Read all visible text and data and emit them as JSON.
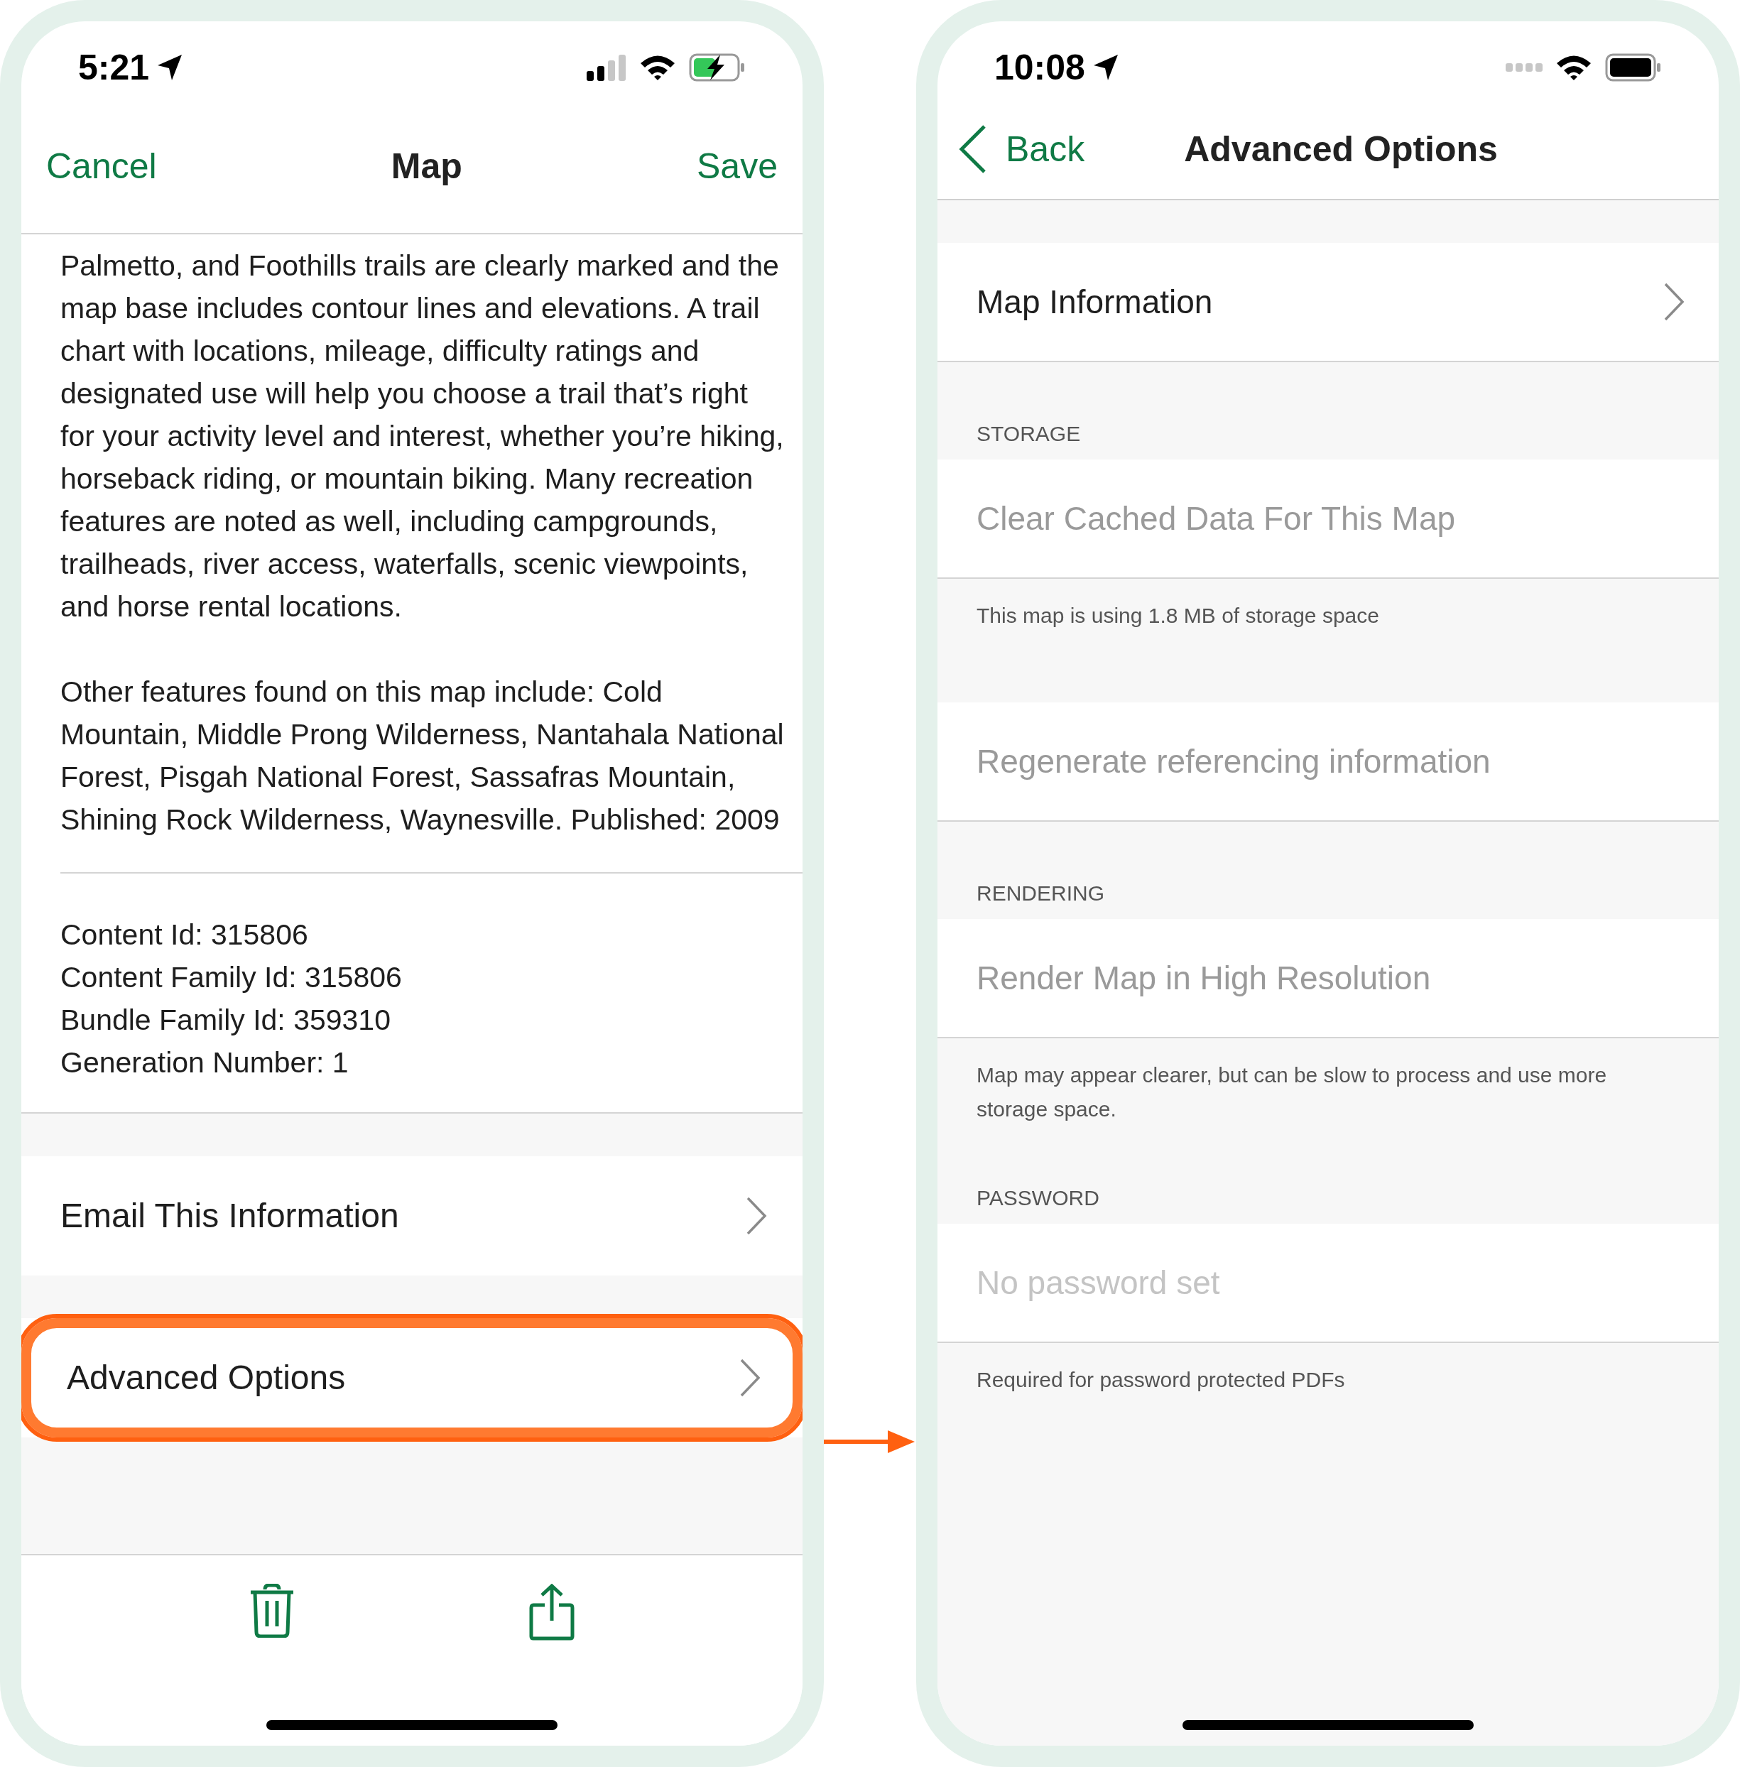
{
  "left_screen": {
    "status_bar": {
      "time": "5:21",
      "charging": true
    },
    "nav": {
      "cancel": "Cancel",
      "title": "Map",
      "save": "Save"
    },
    "description": [
      "Palmetto, and Foothills trails are clearly marked and the map base includes contour lines and elevations. A trail chart with locations, mileage, difficulty ratings and designated use will help you choose a trail that’s right for your activity level and interest, whether you’re hiking, horseback riding, or mountain biking. Many recreation features are noted as well, including campgrounds, trailheads, river access, waterfalls, scenic viewpoints, and horse rental locations.",
      "Other features found on this map include: Cold Mountain, Middle Prong Wilderness, Nantahala National Forest, Pisgah National Forest, Sassafras Mountain, Shining Rock Wilderness, Waynesville. Published: 2009"
    ],
    "ids": [
      "Content Id: 315806",
      "Content Family Id: 315806",
      "Bundle Family Id: 359310",
      "Generation Number: 1"
    ],
    "menu": [
      {
        "label": "Email This Information",
        "highlighted": false
      },
      {
        "label": "Advanced Options",
        "highlighted": true
      }
    ]
  },
  "right_screen": {
    "status_bar": {
      "time": "10:08",
      "charging": false
    },
    "nav": {
      "back": "Back",
      "title": "Advanced Options"
    },
    "sections": [
      {
        "items": [
          {
            "label": "Map Information",
            "disabled": false,
            "chevron": true
          }
        ]
      },
      {
        "header": "STORAGE",
        "items": [
          {
            "label": "Clear Cached Data For This Map",
            "disabled": true,
            "chevron": false
          }
        ],
        "footer": "This map is using 1.8 MB of storage space"
      },
      {
        "items": [
          {
            "label": "Regenerate referencing information",
            "disabled": true,
            "chevron": false
          }
        ]
      },
      {
        "header": "RENDERING",
        "items": [
          {
            "label": "Render Map in High Resolution",
            "disabled": true,
            "chevron": false
          }
        ],
        "footer": "Map may appear clearer, but can be slow to process and use more storage space."
      },
      {
        "header": "PASSWORD",
        "items": [
          {
            "label": "No password set",
            "disabled": true,
            "chevron": false,
            "kind": "placeholder"
          }
        ],
        "footer": "Required for password protected PDFs"
      }
    ]
  }
}
